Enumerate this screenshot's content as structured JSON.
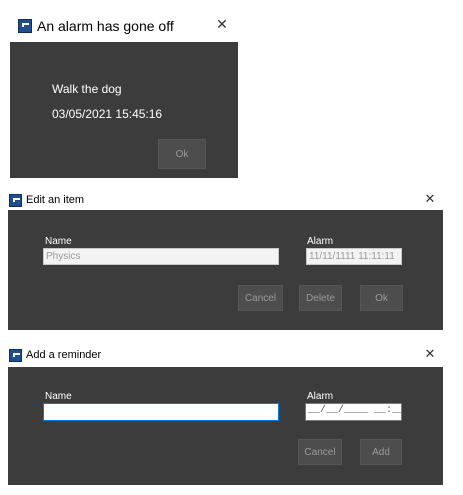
{
  "alarm_dialog": {
    "title": "An alarm has gone off",
    "message": "Walk the dog",
    "datetime": "03/05/2021 15:45:16",
    "ok_label": "Ok",
    "close_glyph": "✕"
  },
  "edit_dialog": {
    "title": "Edit an item",
    "name_label": "Name",
    "name_value": "Physics",
    "alarm_label": "Alarm",
    "alarm_value": "11/11/1111 11:11:11",
    "cancel_label": "Cancel",
    "delete_label": "Delete",
    "ok_label": "Ok",
    "close_glyph": "✕"
  },
  "add_dialog": {
    "title": "Add a reminder",
    "name_label": "Name",
    "name_value": "",
    "alarm_label": "Alarm",
    "alarm_mask": "__/__/____ __:__:__",
    "cancel_label": "Cancel",
    "add_label": "Add",
    "close_glyph": "✕"
  },
  "colors": {
    "dialog_body": "#3c3c3c",
    "button_face": "#4d4d4d",
    "button_text": "#9a9a9a",
    "focus_border": "#0078d7",
    "icon_blue": "#1e4e8c"
  }
}
